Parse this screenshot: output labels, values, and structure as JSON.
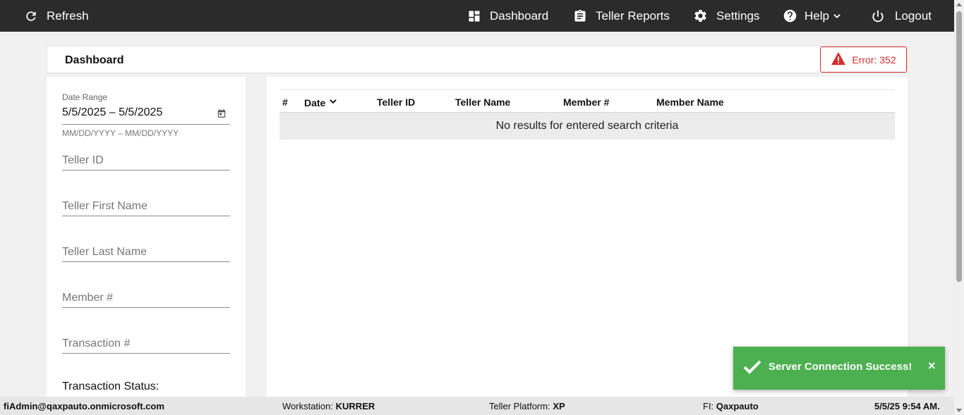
{
  "nav": {
    "refresh_label": "Refresh",
    "dashboard_label": "Dashboard",
    "teller_reports_label": "Teller Reports",
    "settings_label": "Settings",
    "help_label": "Help",
    "logout_label": "Logout"
  },
  "header": {
    "title": "Dashboard",
    "error_label": "Error: 352"
  },
  "filters": {
    "date_range_label": "Date Range",
    "date_range_value": "5/5/2025 – 5/5/2025",
    "date_range_hint": "MM/DD/YYYY – MM/DD/YYYY",
    "teller_id_placeholder": "Teller ID",
    "teller_first_name_placeholder": "Teller First Name",
    "teller_last_name_placeholder": "Teller Last Name",
    "member_number_placeholder": "Member #",
    "transaction_number_placeholder": "Transaction #",
    "transaction_status_label": "Transaction Status:"
  },
  "table": {
    "columns": [
      "#",
      "Date",
      "Teller ID",
      "Teller Name",
      "Member #",
      "Member Name"
    ],
    "empty_message": "No results for entered search criteria"
  },
  "toast": {
    "message": "Server Connection Success!",
    "close_symbol": "×"
  },
  "footer": {
    "user": "fiAdmin@qaxpauto.onmicrosoft.com",
    "workstation_label": "Workstation:",
    "workstation_value": "KURRER",
    "teller_platform_label": "Teller Platform:",
    "teller_platform_value": "XP",
    "fi_label": "FI:",
    "fi_value": "Qaxpauto",
    "datetime": "5/5/25 9:54 AM."
  },
  "colors": {
    "topbar": "#2b2b2b",
    "error": "#d32f2f",
    "toast": "#4caf50"
  },
  "icons": {
    "refresh": "refresh-icon",
    "dashboard": "dashboard-icon",
    "reports": "clipboard-icon",
    "settings": "gear-icon",
    "help": "help-circle-icon",
    "logout": "power-icon",
    "error": "warning-icon",
    "calendar": "calendar-icon",
    "success": "check-icon"
  }
}
